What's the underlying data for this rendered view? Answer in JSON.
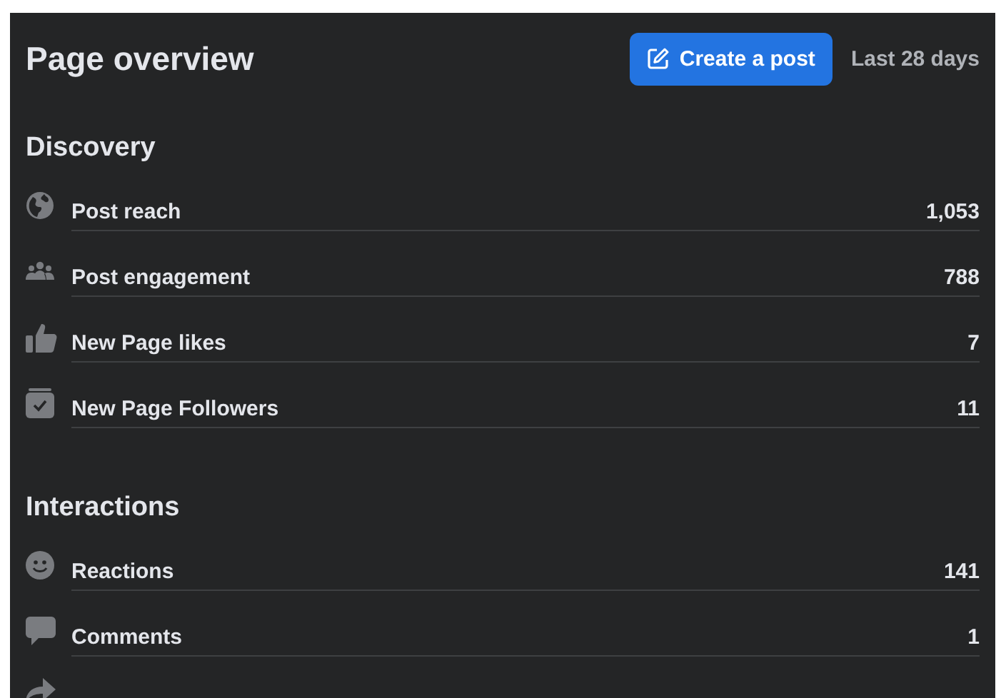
{
  "header": {
    "title": "Page overview",
    "create_button": "Create a post",
    "period": "Last 28 days"
  },
  "sections": [
    {
      "title": "Discovery",
      "rows": [
        {
          "kind": "globe",
          "label": "Post reach",
          "value": "1,053"
        },
        {
          "kind": "people",
          "label": "Post engagement",
          "value": "788"
        },
        {
          "kind": "thumb",
          "label": "New Page likes",
          "value": "7"
        },
        {
          "kind": "follow",
          "label": "New Page Followers",
          "value": "11"
        }
      ]
    },
    {
      "title": "Interactions",
      "rows": [
        {
          "kind": "smile",
          "label": "Reactions",
          "value": "141"
        },
        {
          "kind": "comment",
          "label": "Comments",
          "value": "1"
        },
        {
          "kind": "share"
        }
      ]
    }
  ]
}
